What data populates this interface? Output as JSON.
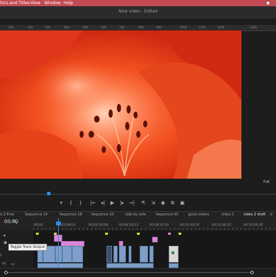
{
  "menubar": {
    "items": [
      "hics and Titles",
      "View",
      "Window",
      "Help"
    ]
  },
  "document": {
    "title": "New video - Edited"
  },
  "ruler": {
    "numbers": [
      "100",
      "200",
      "300",
      "400",
      "500",
      "600",
      "700",
      "800",
      "900",
      "1000",
      "1100",
      "1200",
      "1300"
    ]
  },
  "program_monitor": {
    "resolution_label": "Full"
  },
  "transport": {
    "controls": [
      "marker-icon",
      "in-point-icon",
      "out-point-icon",
      "go-to-in-icon",
      "step-back-icon",
      "play-icon",
      "step-forward-icon",
      "go-to-out-icon",
      "lift-icon",
      "extract-icon",
      "export-frame-icon",
      "compare-icon",
      "overwrite-icon"
    ],
    "glyphs": [
      "▾",
      "{",
      "}",
      "|←",
      "◂|",
      "▶",
      "|▸",
      "→|",
      "⇱",
      "⇲",
      "◉",
      "⧉",
      "▣"
    ]
  },
  "sequence_tabs": {
    "tabs": [
      "o 2 final",
      "Sequence 19",
      "Sequence 18",
      "Sequence 20",
      "side by side",
      "Sequence 03",
      "good videos",
      "video 1",
      "video 2 draft"
    ],
    "active_index": 8,
    "close_glyph": "≡"
  },
  "timeline": {
    "timecodes": [
      "00;00",
      "00;02;08;04",
      "00;04;16;08",
      "00;06;24;12",
      "00;08;32;16",
      "00;10;40;20",
      "00;12;48;22",
      "00;14;56;26"
    ],
    "track_labels": [
      "A1",
      "1"
    ],
    "tooltip": "Toggle Track Output"
  },
  "colors": {
    "menubar_bg": "#c24a52",
    "accent_blue": "#2d8ceb",
    "clip_blue": "#7d9fc9",
    "clip_pink": "#d987d8"
  }
}
